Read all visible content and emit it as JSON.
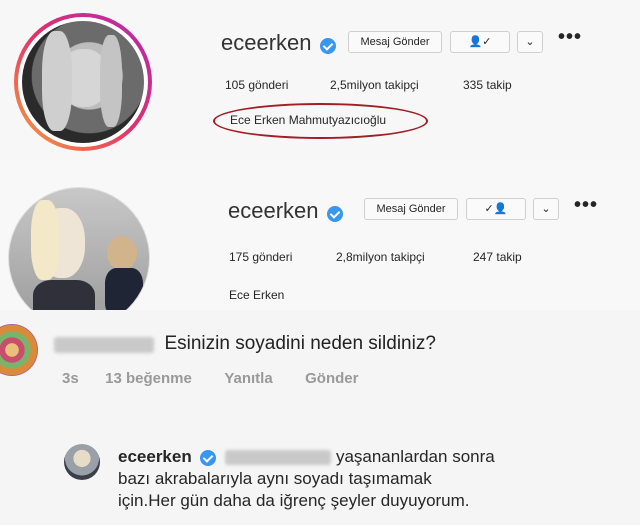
{
  "profile1": {
    "username": "eceerken",
    "message_button": "Mesaj Gönder",
    "posts": "105 gönderi",
    "followers": "2,5milyon takipçi",
    "following": "335 takip",
    "full_name": "Ece Erken Mahmutyazıcıoğlu",
    "more": "•••"
  },
  "profile2": {
    "username": "eceerken",
    "message_button": "Mesaj Gönder",
    "posts": "175 gönderi",
    "followers": "2,8milyon takipçi",
    "following": "247 takip",
    "full_name": "Ece Erken",
    "more": "•••"
  },
  "comment": {
    "text": "Esinizin soyadini neden sildiniz?",
    "time": "3s",
    "likes": "13 beğenme",
    "reply_action": "Yanıtla",
    "send_action": "Gönder"
  },
  "reply": {
    "username": "eceerken",
    "text_part1": "yaşananlardan sonra",
    "text_part2": "bazı akrabalarıyla aynı soyadı taşımamak",
    "text_part3": "için.Her gün daha da iğrenç şeyler duyuyorum."
  },
  "colors": {
    "verified": "#3897f0",
    "highlight_ellipse": "#a01e24"
  }
}
